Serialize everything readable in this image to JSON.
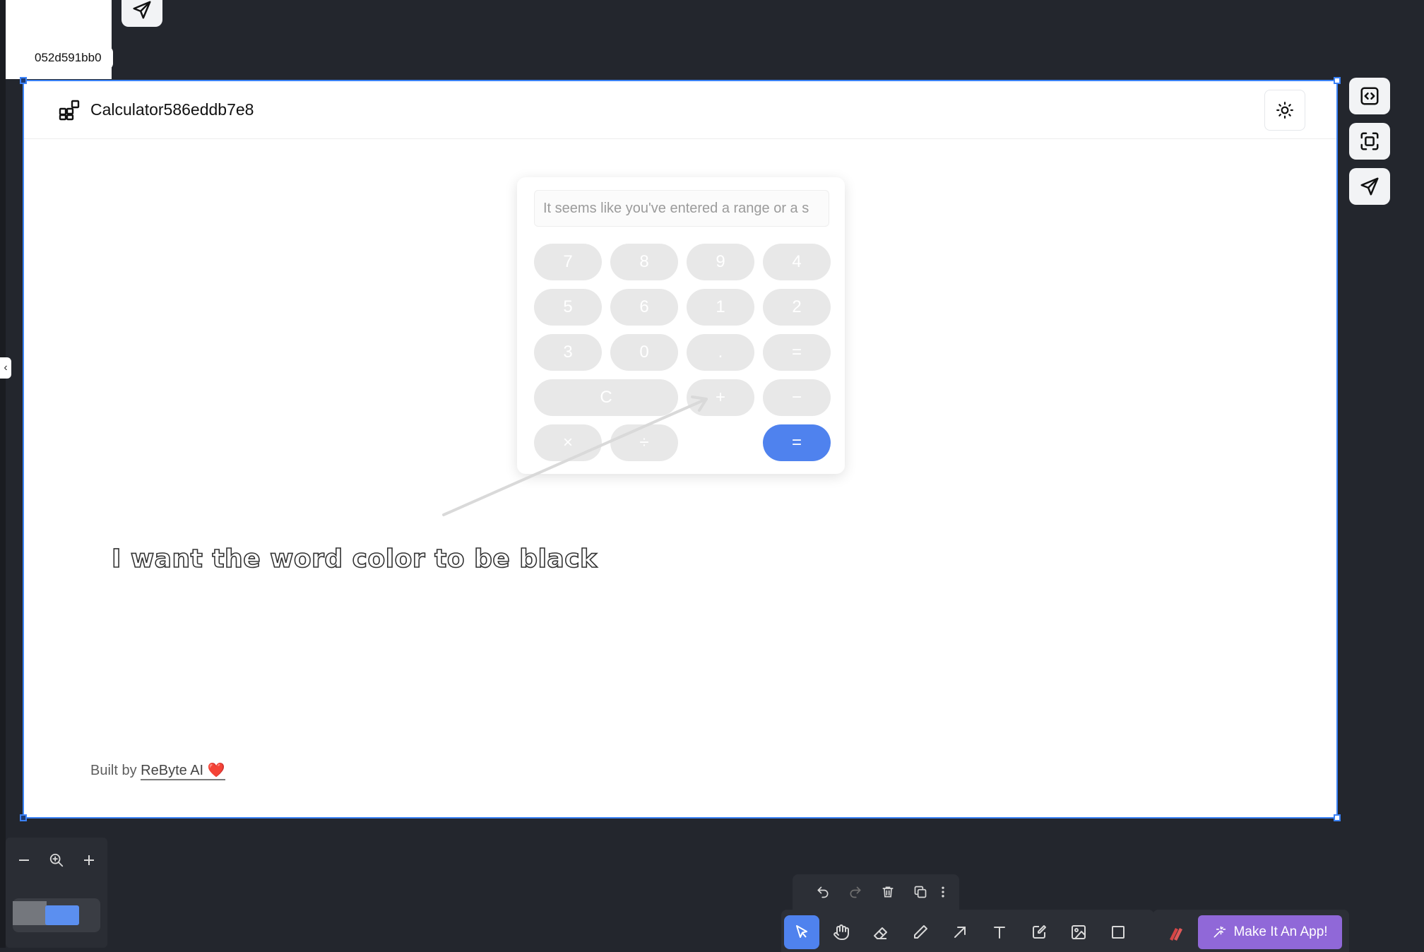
{
  "canvas": {
    "frame_tag": "052d591bb0"
  },
  "app": {
    "title": "Calculator586eddb7e8",
    "display_value": "It seems like you've entered a range or a s",
    "keys": [
      "7",
      "8",
      "9",
      "4",
      "5",
      "6",
      "1",
      "2",
      "3",
      "0",
      ".",
      "=",
      "C",
      "+",
      "−",
      "×",
      "÷",
      "="
    ],
    "footer_prefix": "Built by ",
    "footer_link": "ReByte AI",
    "footer_heart": "❤️"
  },
  "annotation": {
    "text": "I want the word color to be black"
  },
  "zoom_controls": {
    "zoom_out": "−",
    "zoom_in": "+"
  },
  "bottom_toolbar": {
    "make_app_label": "Make It An App!"
  },
  "colors": {
    "canvas_bg": "#23262d",
    "selection": "#3b82f6",
    "accent_blue": "#4f82ee",
    "make_app_purple": "#9068d8",
    "calc_key": "#e8e8e8"
  },
  "icons": {
    "top": "send-icon",
    "frame_side": [
      "code-icon",
      "screenshot-icon",
      "send-icon"
    ],
    "edit": [
      "undo-icon",
      "redo-icon",
      "trash-icon",
      "duplicate-icon",
      "more-icon"
    ],
    "tools": [
      "select-icon",
      "hand-icon",
      "eraser-icon",
      "pencil-icon",
      "arrow-icon",
      "text-icon",
      "note-icon",
      "image-icon",
      "rectangle-icon"
    ]
  }
}
